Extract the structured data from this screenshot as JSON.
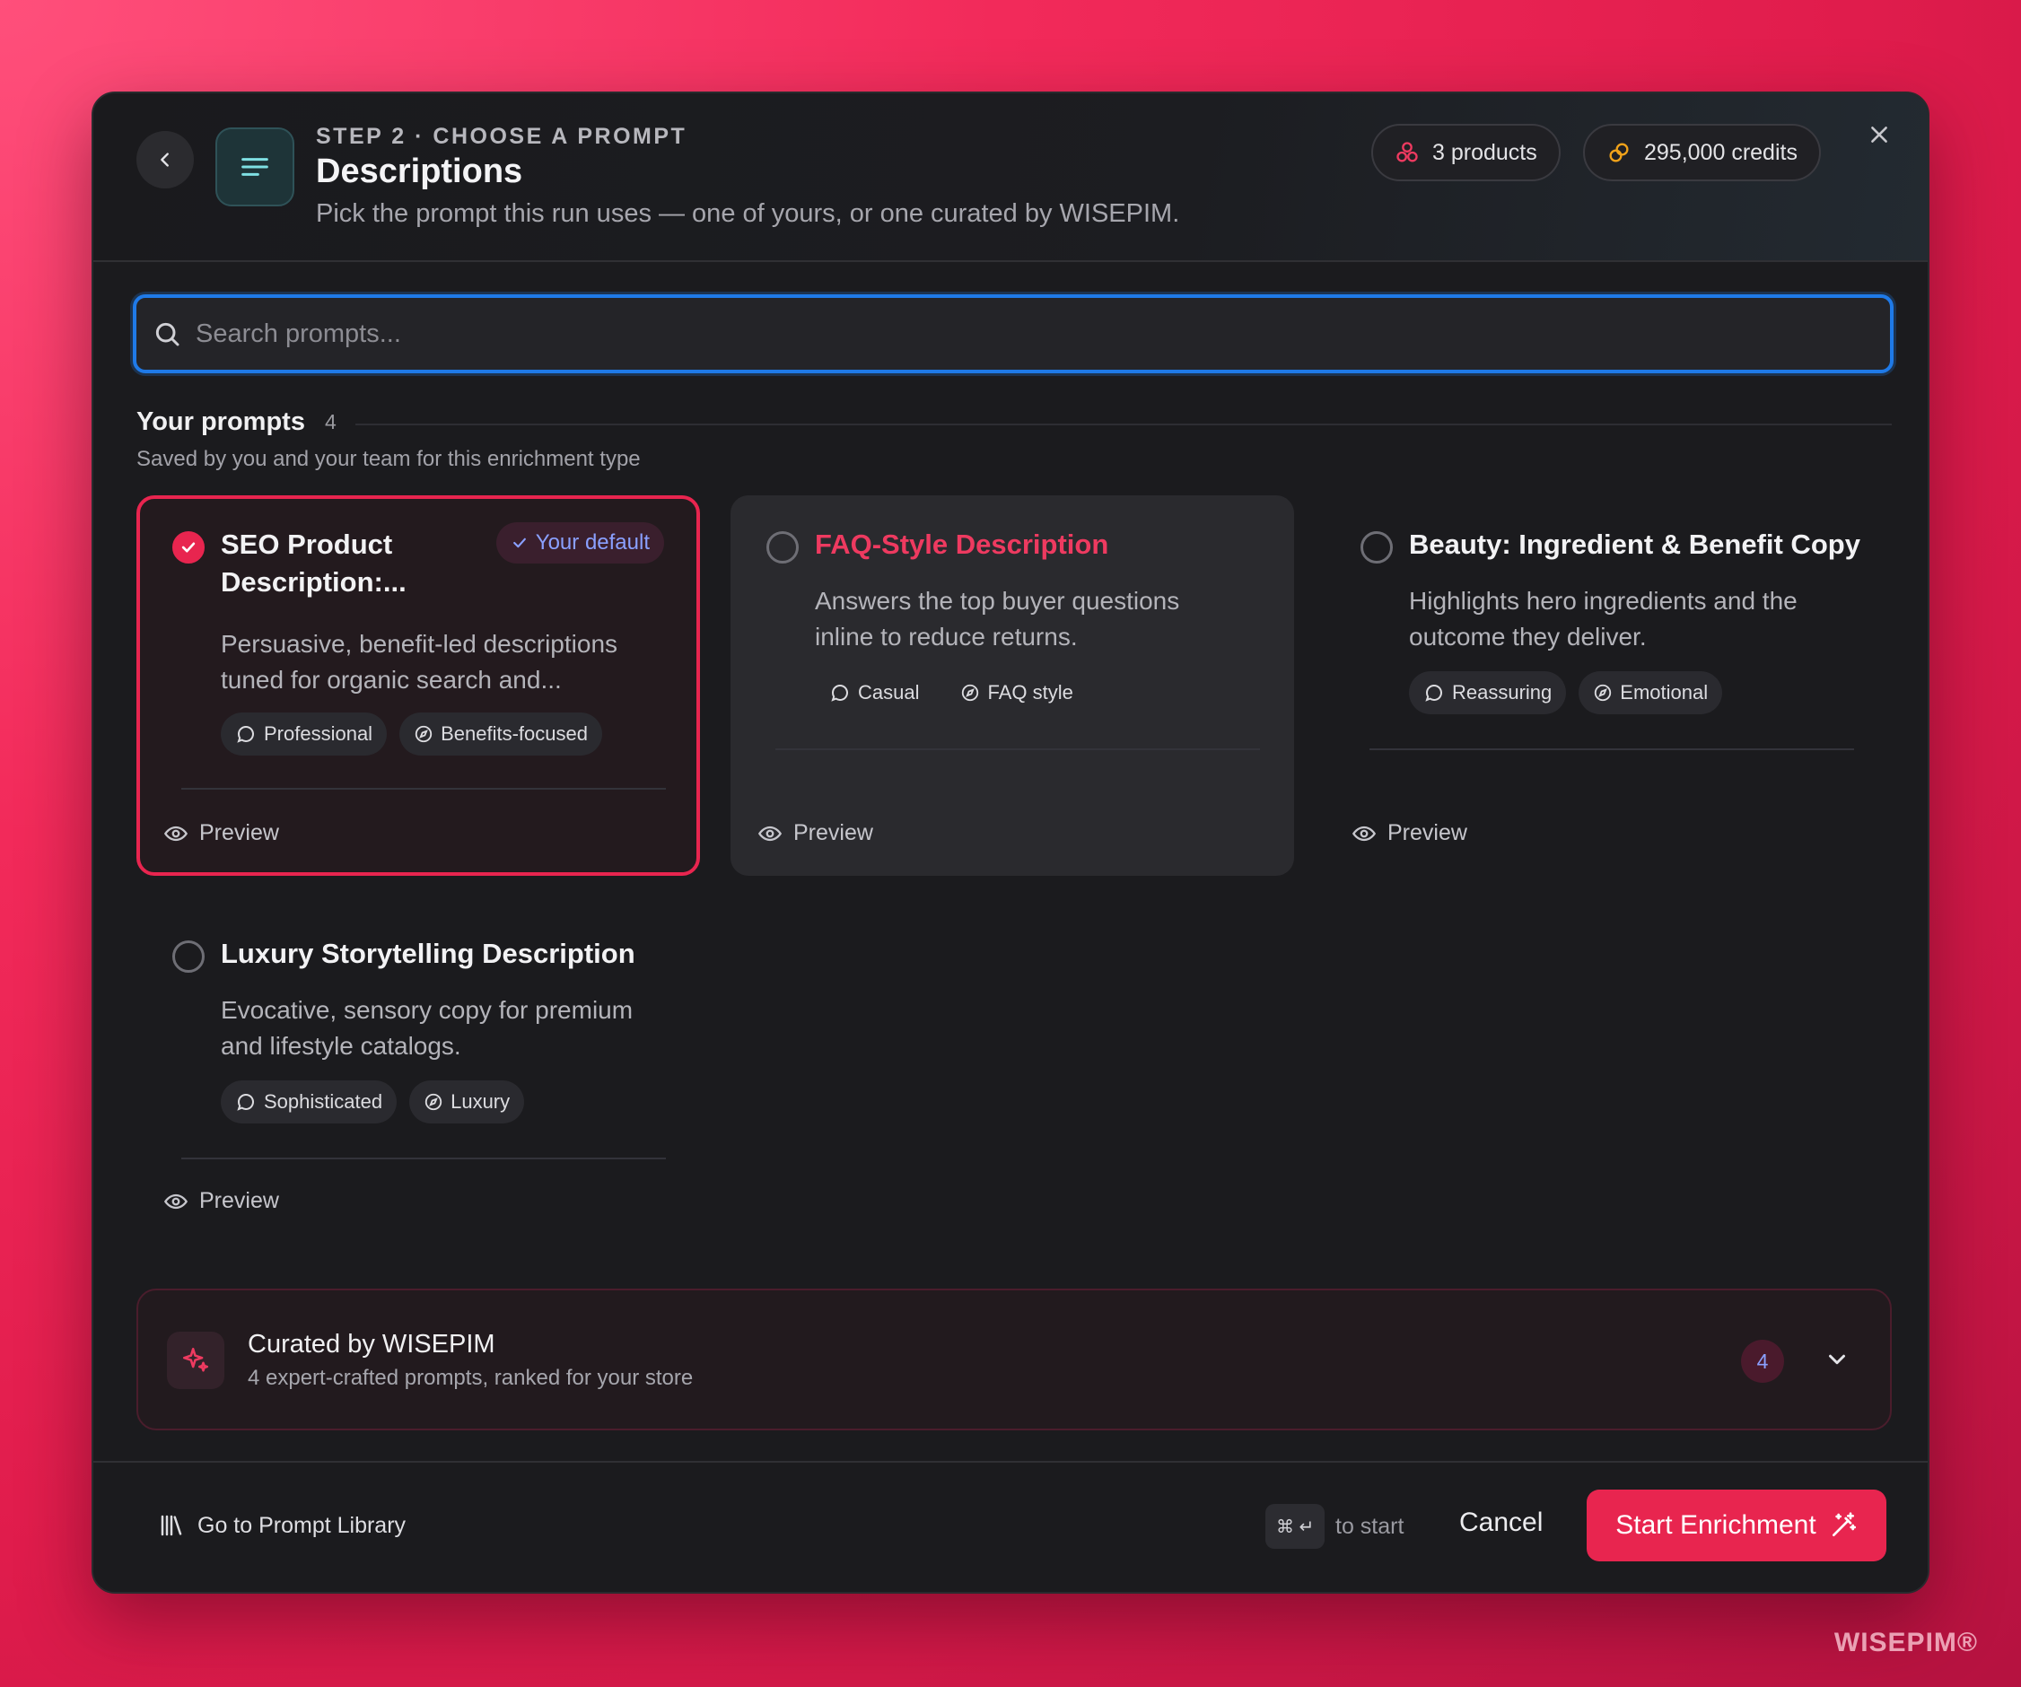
{
  "header": {
    "step_label": "STEP 2 · CHOOSE A PROMPT",
    "title": "Descriptions",
    "subtitle": "Pick the prompt this run uses — one of yours, or one curated by WISEPIM.",
    "products_label": "3 products",
    "credits_label": "295,000 credits"
  },
  "search": {
    "placeholder": "Search prompts..."
  },
  "your_prompts": {
    "title": "Your prompts",
    "count": "4",
    "subtitle": "Saved by you and your team for this enrichment type",
    "default_badge": "Your default",
    "preview_label": "Preview",
    "cards": [
      {
        "title_line1": "SEO Product",
        "title_line2": "Description:...",
        "desc_line1": "Persuasive, benefit-led descriptions",
        "desc_line2": "tuned for organic search and...",
        "tag_tone": "Professional",
        "tag_style": "Benefits-focused"
      },
      {
        "title_line1": "FAQ-Style Description",
        "desc_line1": "Answers the top buyer questions",
        "desc_line2": "inline to reduce returns.",
        "tag_tone": "Casual",
        "tag_style": "FAQ style"
      },
      {
        "title_line1": "Beauty: Ingredient & Benefit Copy",
        "desc_line1": "Highlights hero ingredients and the",
        "desc_line2": "outcome they deliver.",
        "tag_tone": "Reassuring",
        "tag_style": "Emotional"
      },
      {
        "title_line1": "Luxury Storytelling Description",
        "desc_line1": "Evocative, sensory copy for premium",
        "desc_line2": "and lifestyle catalogs.",
        "tag_tone": "Sophisticated",
        "tag_style": "Luxury"
      }
    ]
  },
  "curated": {
    "title": "Curated by WISEPIM",
    "subtitle": "4 expert-crafted prompts, ranked for your store",
    "count": "4"
  },
  "footer": {
    "library_label": "Go to Prompt Library",
    "kbd_label": "⌘ ↵",
    "kbd_hint": "to start",
    "cancel_label": "Cancel",
    "start_label": "Start Enrichment"
  },
  "watermark": "WISEPIM®",
  "colors": {
    "accent": "#e8254f",
    "focus": "#1f7ae8",
    "badge_text": "#8aa0ff"
  },
  "icons": [
    "chevron-left-icon",
    "menu-lines-icon",
    "products-icon",
    "credits-icon",
    "close-icon",
    "search-icon",
    "check-icon",
    "chat-bubble-icon",
    "compass-icon",
    "eye-icon",
    "sparkle-icon",
    "chevron-down-icon",
    "library-icon",
    "magic-wand-icon"
  ]
}
